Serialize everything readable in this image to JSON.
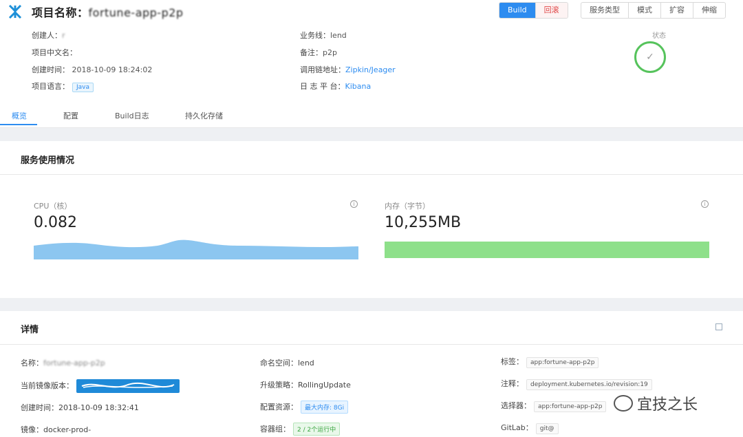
{
  "header": {
    "title_prefix": "项目名称：",
    "title_name": "fortune-app-p2p",
    "actions": [
      "Build",
      "回滚"
    ],
    "menu": [
      "服务类型",
      "模式",
      "扩容",
      "伸缩"
    ]
  },
  "info": {
    "creator_label": "创建人：",
    "creator_value": "r",
    "cn_name_label": "项目中文名：",
    "create_time_label": "创建时间：",
    "create_time_value": "2018-10-09 18:24:02",
    "lang_label": "项目语言：",
    "lang_value": "Java",
    "biz_label": "业务线：",
    "biz_value": "lend",
    "remark_label": "备注：",
    "remark_value": "p2p",
    "trace_label": "调用链地址：",
    "trace_value": "Zipkin/Jeager",
    "log_label": "日 志 平 台：",
    "log_value": "Kibana"
  },
  "status": {
    "label": "状态",
    "icon": "check-icon"
  },
  "tabs": [
    "概览",
    "配置",
    "Build日志",
    "持久化存储"
  ],
  "usage": {
    "title": "服务使用情况",
    "cpu_label": "CPU（核）",
    "cpu_value": "0.082",
    "mem_label": "内存（字节）",
    "mem_value": "10,255MB"
  },
  "details": {
    "title": "详情",
    "name_label": "名称：",
    "name_value": "fortune-app-p2p",
    "image_ver_label": "当前镜像版本：",
    "created_label": "创建时间：",
    "created_value": "2018-10-09 18:32:41",
    "image_label": "镜像：",
    "image_value": "docker-prod-",
    "ns_label": "命名空间：",
    "ns_value": "lend",
    "strategy_label": "升级策略：",
    "strategy_value": "RollingUpdate",
    "resource_label": "配置资源：",
    "resource_value": "最大内存: 8Gi",
    "pods_label": "容器组：",
    "pods_value": "2 / 2个运行中",
    "labels_label": "标签：",
    "labels_value": "app:fortune-app-p2p",
    "annotations_label": "注释：",
    "annotations_value": "deployment.kubernetes.io/revision:19",
    "selector_label": "选择器：",
    "selector_value": "app:fortune-app-p2p",
    "gitlab_label": "GitLab：",
    "gitlab_value": "git@"
  },
  "watermark": "宜技之长",
  "colors": {
    "accent": "#2d8cf0",
    "cpu_area": "#8cc6f0",
    "mem_bar": "#8ee08a",
    "status": "#56c35c"
  }
}
